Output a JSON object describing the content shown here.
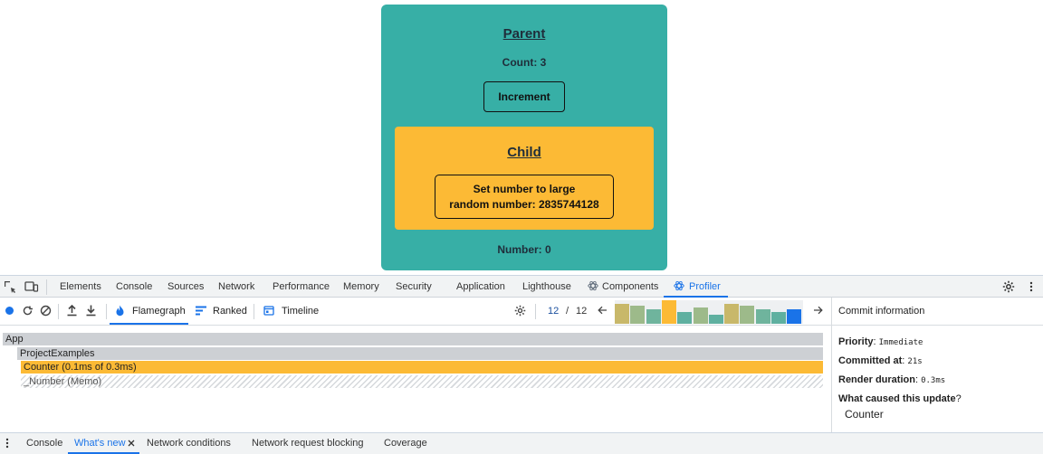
{
  "app": {
    "parent_title": "Parent",
    "count_text": "Count: 3",
    "increment_label": "Increment",
    "child_title": "Child",
    "set_btn_line1": "Set number to large",
    "set_btn_line2": "random number: 2835744128",
    "number_text": "Number: 0"
  },
  "devtools_tabs": [
    "Elements",
    "Console",
    "Sources",
    "Network",
    "Performance",
    "Memory",
    "Security",
    "Application",
    "Lighthouse",
    "Components",
    "Profiler"
  ],
  "active_tab": "Profiler",
  "profiler": {
    "flamegraph_label": "Flamegraph",
    "ranked_label": "Ranked",
    "timeline_label": "Timeline",
    "commit_current": "12",
    "commit_sep": "/",
    "commit_total": "12",
    "commit_bars": [
      {
        "h": 0.85,
        "color": "#c8b86a"
      },
      {
        "h": 0.75,
        "color": "#9dba8a"
      },
      {
        "h": 0.6,
        "color": "#6fb49d"
      },
      {
        "h": 1.0,
        "color": "#fcba35"
      },
      {
        "h": 0.5,
        "color": "#5fb0a0"
      },
      {
        "h": 0.7,
        "color": "#9dba8a"
      },
      {
        "h": 0.4,
        "color": "#5fb0a0"
      },
      {
        "h": 0.85,
        "color": "#c8b86a"
      },
      {
        "h": 0.75,
        "color": "#9dba8a"
      },
      {
        "h": 0.6,
        "color": "#6fb49d"
      },
      {
        "h": 0.5,
        "color": "#5fb0a0"
      },
      {
        "h": 0.6,
        "color": "#1a73e8"
      }
    ]
  },
  "flamegraph": [
    {
      "label": "App",
      "color": "#cdd0d4"
    },
    {
      "label": "ProjectExamples",
      "color": "#cdd0d4"
    },
    {
      "label": "Counter (0.1ms of 0.3ms)",
      "color": "#fcba35"
    },
    {
      "label": "_Number (Memo)",
      "color": "hatched"
    }
  ],
  "commit_info": {
    "title": "Commit information",
    "priority_label": "Priority",
    "priority_value": "Immediate",
    "committed_label": "Committed at",
    "committed_value": "21s",
    "render_label": "Render duration",
    "render_value": "0.3ms",
    "cause_label": "What caused this update",
    "cause_value": "Counter"
  },
  "drawer": {
    "console_label": "Console",
    "whats_new_label": "What's new",
    "network_conditions_label": "Network conditions",
    "request_blocking_label": "Network request blocking",
    "coverage_label": "Coverage"
  }
}
